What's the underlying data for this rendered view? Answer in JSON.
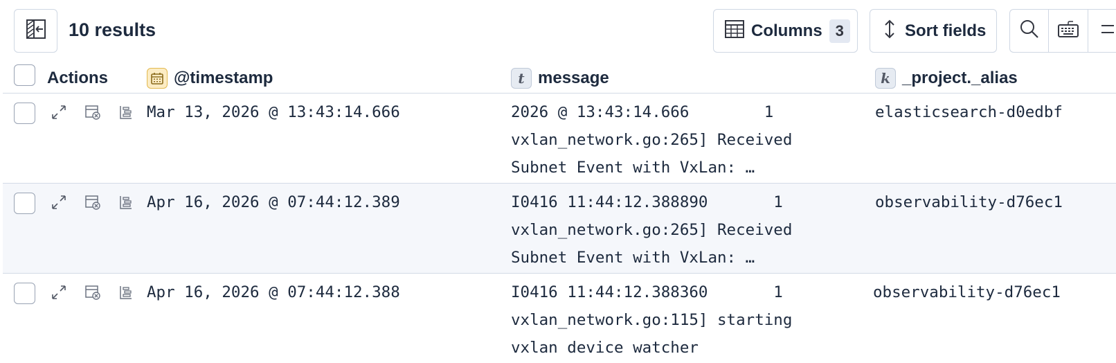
{
  "toolbar": {
    "results_count": "10 results",
    "columns_label": "Columns",
    "columns_count": "3",
    "sort_label": "Sort fields"
  },
  "table": {
    "headers": {
      "actions": "Actions",
      "timestamp": "@timestamp",
      "message": "message",
      "alias": "_project._alias"
    },
    "field_type_badges": {
      "message": "t",
      "alias": "k"
    },
    "rows": [
      {
        "timestamp": "Mar 13, 2026 @ 13:43:14.666",
        "message_lines": [
          "2026 @ 13:43:14.666        1",
          "vxlan_network.go:265] Received",
          "Subnet Event with VxLan: …"
        ],
        "alias": "elasticsearch-d0edbf"
      },
      {
        "timestamp": "Apr 16, 2026 @ 07:44:12.389",
        "message_lines": [
          "I0416 11:44:12.388890       1",
          "vxlan_network.go:265] Received",
          "Subnet Event with VxLan: …"
        ],
        "alias": "observability-d76ec1"
      },
      {
        "timestamp": "Apr 16, 2026 @ 07:44:12.388",
        "message_lines": [
          "I0416 11:44:12.388360       1",
          "vxlan_network.go:115] starting",
          "vxlan device watcher"
        ],
        "alias": "observability-d76ec1"
      }
    ]
  },
  "colors": {
    "text": "#1d2a3e",
    "border": "#d3dae6",
    "shaded_row": "#f5f7fb",
    "date_badge_bg": "#fcecc4",
    "date_badge_border": "#e3b94f"
  }
}
